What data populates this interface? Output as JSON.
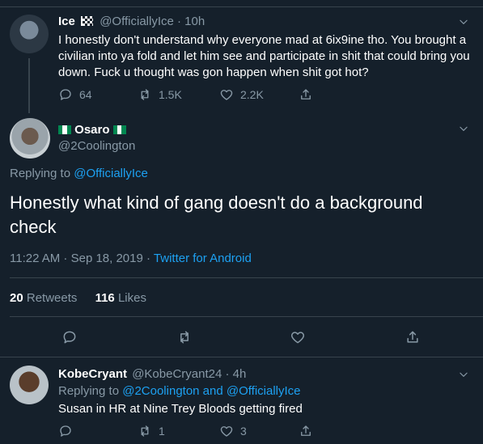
{
  "tweet1": {
    "name": "Ice",
    "name_suffix_icon": "checkered-flag-icon",
    "handle": "@OfficiallyIce",
    "time": "· 10h",
    "text": "I honestly don't understand why everyone mad at 6ix9ine tho. You brought a civilian into ya fold and let him see and participate in shit that could bring you down. Fuck u thought was gon happen when shit got hot?",
    "replies": "64",
    "retweets": "1.5K",
    "likes": "2.2K"
  },
  "tweet2": {
    "name": "Osaro",
    "flag_colors": [
      "#008751",
      "#ffffff",
      "#008751"
    ],
    "handle": "@2Coolington",
    "replying_to_label": "Replying to",
    "replying_to_handle": "@OfficiallyIce",
    "text": "Honestly what kind of gang doesn't do a background check",
    "timestamp": "11:22 AM · Sep 18, 2019 ·",
    "source": "Twitter for Android",
    "retweets_count": "20",
    "retweets_label": "Retweets",
    "likes_count": "116",
    "likes_label": "Likes"
  },
  "tweet3": {
    "name": "KobeCryant",
    "handle": "@KobeCryant24",
    "time": "· 4h",
    "replying_to_label": "Replying to",
    "replying_to_handles": "@2Coolington and @OfficiallyIce",
    "text": "Susan in HR at Nine Trey Bloods getting fired",
    "retweets": "1",
    "likes": "3"
  },
  "colors": {
    "background": "#15202b",
    "accent": "#1da1f2",
    "muted": "#8899a6",
    "divider": "#38444d"
  }
}
